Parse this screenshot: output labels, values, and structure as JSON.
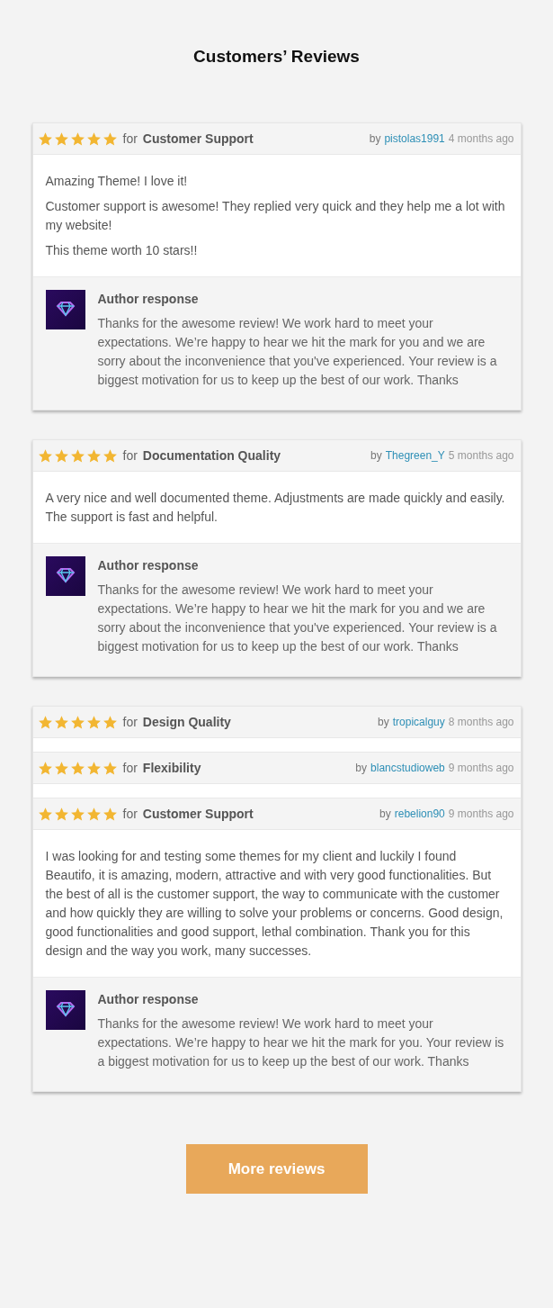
{
  "title": "Customers’ Reviews",
  "cards": [
    {
      "reviews": [
        {
          "stars": 5,
          "for_label": "for",
          "topic": "Customer Support",
          "by_label": "by",
          "author": "pistolas1991",
          "time": "4 months ago",
          "paragraphs": [
            "Amazing Theme! I love it!",
            "Customer support is awesome! They replied very quick and they help me a lot with my website!",
            "This theme worth 10 stars!!"
          ],
          "response": {
            "title": "Author response",
            "text": "Thanks for the awesome review! We work hard to meet your expectations. We’re happy to hear we hit the mark for you and we are sorry about the inconvenience that you've experienced. Your review is a biggest motivation for us to keep up the best of our work. Thanks"
          }
        }
      ]
    },
    {
      "reviews": [
        {
          "stars": 5,
          "for_label": "for",
          "topic": "Documentation Quality",
          "by_label": "by",
          "author": "Thegreen_Y",
          "time": "5 months ago",
          "paragraphs": [
            "A very nice and well documented theme. Adjustments are made quickly and easily.\nThe support is fast and helpful."
          ],
          "response": {
            "title": "Author response",
            "text": "Thanks for the awesome review! We work hard to meet your expectations. We’re happy to hear we hit the mark for you and we are sorry about the inconvenience that you've experienced. Your review is a biggest motivation for us to keep up the best of our work. Thanks"
          }
        }
      ]
    },
    {
      "reviews": [
        {
          "stars": 5,
          "for_label": "for",
          "topic": "Design Quality",
          "by_label": "by",
          "author": "tropicalguy",
          "time": "8 months ago"
        },
        {
          "stars": 5,
          "for_label": "for",
          "topic": "Flexibility",
          "by_label": "by",
          "author": "blancstudioweb",
          "time": "9 months ago"
        },
        {
          "stars": 5,
          "for_label": "for",
          "topic": "Customer Support",
          "by_label": "by",
          "author": "rebelion90",
          "time": "9 months ago",
          "paragraphs": [
            "I was looking for and testing some themes for my client and luckily I found Beautifo, it is amazing, modern, attractive and with very good functionalities. But the best of all is the customer support, the way to communicate with the customer and how quickly they are willing to solve your problems or concerns. Good design, good functionalities and good support, lethal combination. Thank you for this design and the way you work, many successes."
          ],
          "response": {
            "title": "Author response",
            "text": "Thanks for the awesome review! We work hard to meet your expectations. We’re happy to hear we hit the mark for you. Your review is a biggest motivation for us to keep up the best of our work. Thanks"
          }
        }
      ]
    }
  ],
  "button": "More reviews"
}
